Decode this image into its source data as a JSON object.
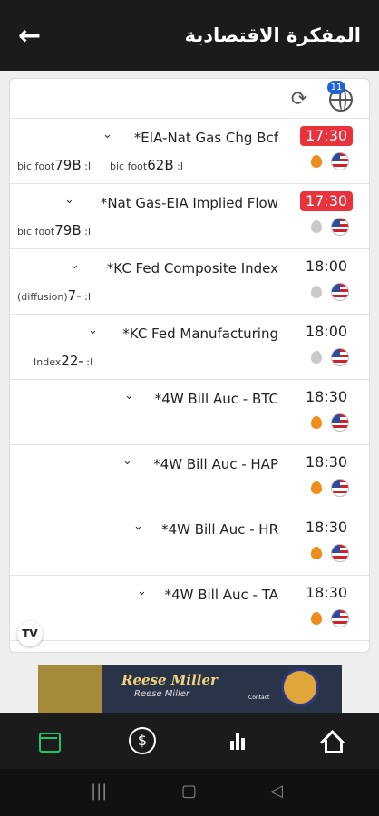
{
  "header": {
    "title": "المفكرة الاقتصادية"
  },
  "toolbar": {
    "badge_count": "11"
  },
  "events": [
    {
      "title": "*EIA-Nat Gas Chg Bcf",
      "time": "17:30",
      "hot": true,
      "impact": "high",
      "actual_value": "79B",
      "actual_label": "bic foot",
      "actual_suffix": ":I",
      "forecast_value": "62B",
      "forecast_label": "bic foot",
      "forecast_suffix": ":I"
    },
    {
      "title": "*Nat Gas-EIA Implied Flow",
      "time": "17:30",
      "hot": true,
      "impact": "low",
      "actual_value": "79B",
      "actual_label": "bic foot",
      "actual_suffix": ":I"
    },
    {
      "title": "*KC Fed Composite Index",
      "time": "18:00",
      "hot": false,
      "impact": "low",
      "actual_value": "7-",
      "actual_label": "(diffusion)",
      "actual_suffix": ":I"
    },
    {
      "title": "*KC Fed Manufacturing",
      "time": "18:00",
      "hot": false,
      "impact": "low",
      "actual_value": "22-",
      "actual_label": "Index",
      "actual_suffix": ":I"
    },
    {
      "title": "*4W Bill Auc - BTC",
      "time": "18:30",
      "hot": false,
      "impact": "high"
    },
    {
      "title": "*4W Bill Auc - HAP",
      "time": "18:30",
      "hot": false,
      "impact": "high"
    },
    {
      "title": "*4W Bill Auc - HR",
      "time": "18:30",
      "hot": false,
      "impact": "high"
    },
    {
      "title": "*4W Bill Auc - TA",
      "time": "18:30",
      "hot": false,
      "impact": "high"
    }
  ],
  "ad": {
    "name": "Reese Miller",
    "sub": "Reese Miller",
    "contact": "Contact"
  },
  "icons": {
    "back": "arrow-left-icon",
    "refresh": "refresh-icon",
    "globe": "globe-icon",
    "fire": "fire-icon",
    "flag": "us-flag-icon",
    "calendar": "calendar-icon",
    "dollar": "dollar-icon",
    "chart": "bar-chart-icon",
    "home": "home-icon"
  },
  "colors": {
    "accent_green": "#1ec46b",
    "hot_time": "#e8323c",
    "fire": "#f08c1a",
    "badge": "#1e63d6"
  }
}
